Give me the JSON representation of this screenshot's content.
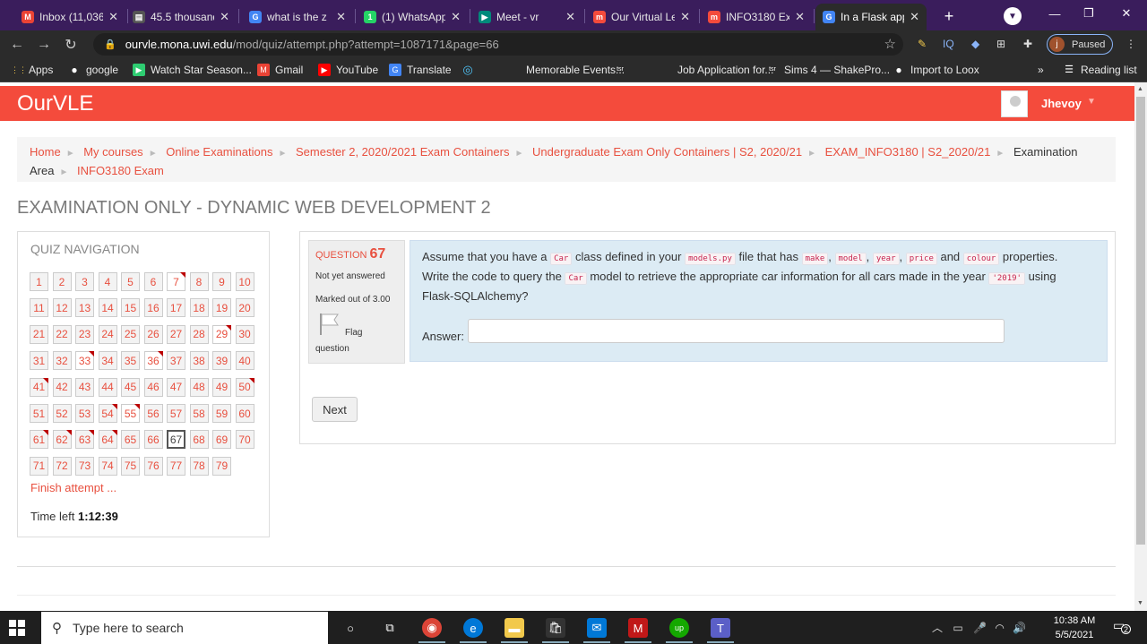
{
  "browser": {
    "tabs": [
      {
        "title": "Inbox (11,036",
        "icon": "gmail-icon",
        "color": "#ea4335",
        "glyph": "M"
      },
      {
        "title": "45.5 thousand",
        "icon": "page-icon",
        "color": "#555",
        "glyph": "▤"
      },
      {
        "title": "what is the z",
        "icon": "google-icon",
        "color": "#4285f4",
        "glyph": "G"
      },
      {
        "title": "(1) WhatsApp",
        "icon": "whatsapp-icon",
        "color": "#25d366",
        "glyph": "1"
      },
      {
        "title": "Meet - vr",
        "icon": "meet-icon",
        "color": "#00897b",
        "glyph": "▶"
      },
      {
        "title": "Our Virtual Le",
        "icon": "moodle-icon",
        "color": "#f44b3c",
        "glyph": "m"
      },
      {
        "title": "INFO3180 Exa",
        "icon": "moodle-icon",
        "color": "#f44b3c",
        "glyph": "m"
      },
      {
        "title": "In a Flask app",
        "icon": "google-icon",
        "color": "#4285f4",
        "glyph": "G"
      }
    ],
    "newtab": "+",
    "window_controls": {
      "minimize": "—",
      "maximize": "❐",
      "close": "✕"
    },
    "url_host": "ourvle.mona.uwi.edu",
    "url_path": "/mod/quiz/attempt.php?attempt=1087171&page=66",
    "ext_label": "IQ",
    "profile_initial": "j",
    "profile_status": "Paused",
    "bookmarks": [
      {
        "label": "Apps",
        "icon": "apps-grid-icon"
      },
      {
        "label": "google",
        "icon": "github-icon"
      },
      {
        "label": "Watch Star Season...",
        "icon": "play-icon"
      },
      {
        "label": "Gmail",
        "icon": "gmail-icon"
      },
      {
        "label": "YouTube",
        "icon": "youtube-icon"
      },
      {
        "label": "Translate",
        "icon": "translate-icon"
      },
      {
        "label": "",
        "icon": "circle-play-icon"
      },
      {
        "label": "Memorable Events...",
        "icon": "blank-icon"
      },
      {
        "label": "",
        "icon": "tsr-icon"
      },
      {
        "label": "Job Application for...",
        "icon": "blank-icon"
      },
      {
        "label": "Sims 4 — ShakePro...",
        "icon": "tsr-icon"
      },
      {
        "label": "Import to Loox",
        "icon": "github-icon"
      }
    ],
    "more_bookmarks": "»",
    "reading_list": "Reading list"
  },
  "site": {
    "brand": "OurVLE",
    "username": "Jhevoy"
  },
  "breadcrumb": [
    {
      "label": "Home",
      "link": true
    },
    {
      "label": "My courses",
      "link": true
    },
    {
      "label": "Online Examinations",
      "link": true
    },
    {
      "label": "Semester 2, 2020/2021 Exam Containers",
      "link": true
    },
    {
      "label": "Undergraduate Exam Only Containers | S2, 2020/21",
      "link": true
    },
    {
      "label": "EXAM_INFO3180 | S2_2020/21",
      "link": true
    },
    {
      "label": "Examination Area",
      "link": false
    },
    {
      "label": "INFO3180 Exam",
      "link": true
    }
  ],
  "page_title": "EXAMINATION ONLY - DYNAMIC WEB DEVELOPMENT 2",
  "quiz_nav": {
    "title": "QUIZ NAVIGATION",
    "current": 67,
    "total": 79,
    "answered": [
      7,
      29,
      33,
      36,
      55,
      67
    ],
    "flagged": [
      7,
      29,
      33,
      36,
      41,
      50,
      54,
      55,
      61,
      62,
      63,
      64
    ],
    "finish": "Finish attempt ...",
    "time_label": "Time left",
    "time_value": "1:12:39"
  },
  "question": {
    "label": "QUESTION",
    "number": "67",
    "state": "Not yet answered",
    "marks": "Marked out of 3.00",
    "flag_1": "Flag",
    "flag_2": "question",
    "text_parts": [
      {
        "t": "Assume that you have a "
      },
      {
        "c": "Car"
      },
      {
        "t": " class defined in your "
      },
      {
        "c": "models.py"
      },
      {
        "t": " file that has "
      },
      {
        "c": "make"
      },
      {
        "t": ", "
      },
      {
        "c": "model"
      },
      {
        "t": ", "
      },
      {
        "c": "year"
      },
      {
        "t": ", "
      },
      {
        "c": "price"
      },
      {
        "t": " and "
      },
      {
        "c": "colour"
      },
      {
        "t": " properties. Write the code to query the "
      },
      {
        "c": "Car"
      },
      {
        "t": " model to retrieve the appropriate car information for all cars made in the year "
      },
      {
        "c": "'2019'"
      },
      {
        "t": " using Flask-SQLAlchemy?"
      }
    ],
    "answer_label": "Answer:",
    "answer_value": ""
  },
  "next_label": "Next",
  "taskbar": {
    "search_placeholder": "Type here to search",
    "time": "10:38 AM",
    "date": "5/5/2021",
    "notif_count": "2",
    "apps": [
      {
        "icon": "cortana-icon",
        "color": "#1f1f1f",
        "glyph": "○"
      },
      {
        "icon": "task-view-icon",
        "color": "#1f1f1f",
        "glyph": "⧉"
      },
      {
        "icon": "chrome-icon",
        "color": "#db4437",
        "glyph": "◉"
      },
      {
        "icon": "edge-icon",
        "color": "#0078d7",
        "glyph": "e"
      },
      {
        "icon": "file-explorer-icon",
        "color": "#f2c94c",
        "glyph": "▬"
      },
      {
        "icon": "store-icon",
        "color": "#333",
        "glyph": "🛍"
      },
      {
        "icon": "mail-icon",
        "color": "#0078d7",
        "glyph": "✉"
      },
      {
        "icon": "mcafee-icon",
        "color": "#c01818",
        "glyph": "M"
      },
      {
        "icon": "upwork-icon",
        "color": "#14a800",
        "glyph": "up"
      },
      {
        "icon": "teams-icon",
        "color": "#5b5fc7",
        "glyph": "T"
      }
    ]
  }
}
